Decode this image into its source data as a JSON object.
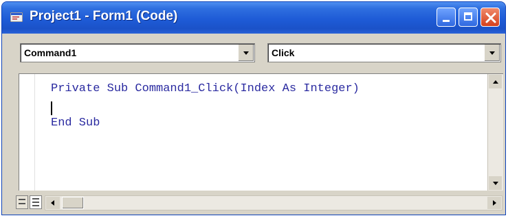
{
  "window": {
    "title": "Project1 - Form1 (Code)",
    "app_icon": "vb-code-window-icon",
    "controls": [
      "minimize-icon",
      "maximize-icon",
      "close-icon"
    ],
    "colors": {
      "titlebar": "#1e5bd6",
      "close": "#d4401c",
      "code_text": "#2a2aa0"
    }
  },
  "combos": {
    "object_value": "Command1",
    "procedure_value": "Click"
  },
  "editor": {
    "lines": [
      "Private Sub Command1_Click(Index As Integer)",
      "",
      "End Sub"
    ]
  },
  "bottom": {
    "view_buttons": [
      "procedure-view-icon",
      "full-module-view-icon"
    ]
  }
}
